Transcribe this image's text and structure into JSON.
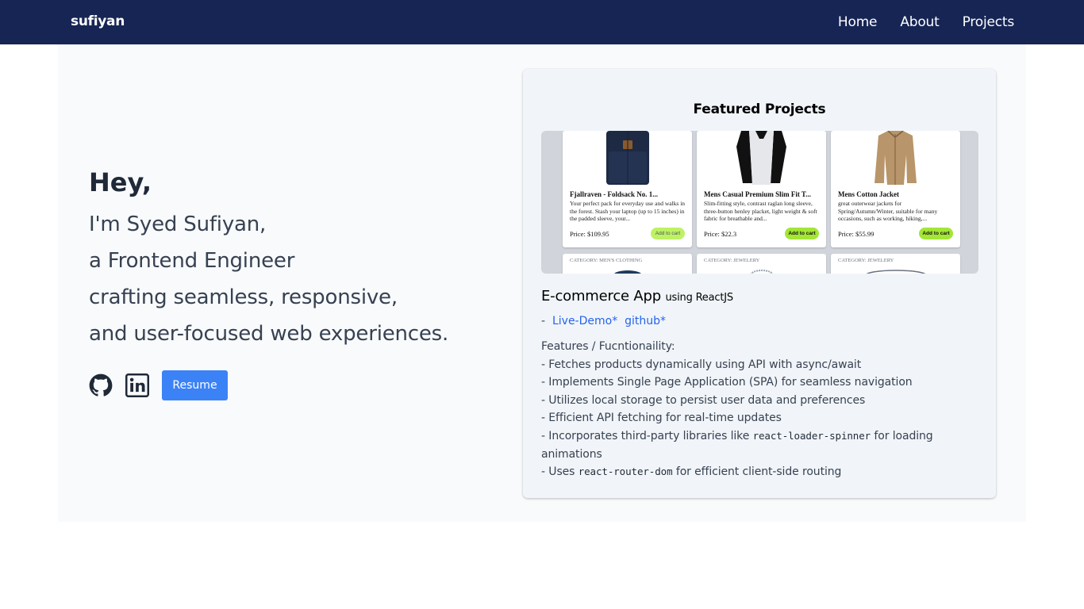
{
  "nav": {
    "brand": "sufiyan",
    "links": [
      "Home",
      "About",
      "Projects"
    ]
  },
  "hero": {
    "greeting": "Hey,",
    "lines": [
      "I'm Syed Sufiyan,",
      "a Frontend Engineer",
      "crafting seamless, responsive,",
      "and user-focused web experiences."
    ],
    "resume_label": "Resume",
    "icons": [
      "github-icon",
      "linkedin-icon"
    ]
  },
  "featured": {
    "title": "Featured Projects",
    "project_name": "E-commerce App",
    "project_tech": "using ReactJS",
    "links_prefix": "-",
    "live_demo": "Live-Demo*",
    "github": "github*",
    "features_heading": "Features / Fucntionaility:",
    "features": [
      {
        "pre": "- Fetches products dynamically using API with async/await"
      },
      {
        "pre": "- Implements Single Page Application (SPA) for seamless navigation"
      },
      {
        "pre": "- Utilizes local storage to persist user data and preferences"
      },
      {
        "pre": "- Efficient API fetching for real-time updates"
      },
      {
        "pre": "- Incorporates third-party libraries like ",
        "code": "react-loader-spinner",
        "post": " for loading animations"
      },
      {
        "pre": "- Uses ",
        "code": "react-router-dom",
        "post": " for efficient client-side routing"
      }
    ],
    "preview": {
      "products": [
        {
          "title": "Fjallraven - Foldsack No. 1...",
          "desc": "Your perfect pack for everyday use and walks in the forest. Stash your laptop (up to 15 inches) in the padded sleeve, your...",
          "price": "Price: $109.95",
          "button": "Add to cart"
        },
        {
          "title": "Mens Casual Premium Slim Fit T...",
          "desc": "Slim-fitting style, contrast raglan long sleeve, three-button henley placket, light weight & soft fabric for breathable and...",
          "price": "Price: $22.3",
          "button": "Add to cart"
        },
        {
          "title": "Mens Cotton Jacket",
          "desc": "great outerwear jackets for Spring/Autumn/Winter, suitable for many occasions, such as working, hiking,...",
          "price": "Price: $55.99",
          "button": "Add to cart"
        }
      ],
      "categories": [
        "CATEGORY: MEN'S CLOTHING",
        "CATEGORY: JEWELERY",
        "CATEGORY: JEWELERY"
      ]
    }
  },
  "colors": {
    "navbar": "#172554",
    "accent": "#3b82f6",
    "link": "#2563eb",
    "cart_button": "#a3e635"
  }
}
